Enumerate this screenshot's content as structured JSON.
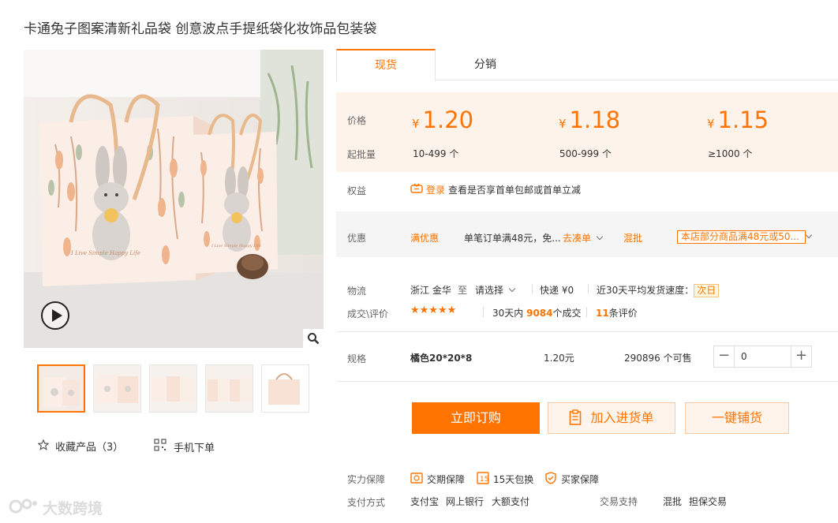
{
  "title": "卡通兔子图案清新礼品袋 创意波点手提纸袋化妆饰品包装袋",
  "tabs": [
    "现货",
    "分销"
  ],
  "price_section": {
    "price_label": "价格",
    "moq_label": "起批量",
    "currency": "¥",
    "tiers": [
      {
        "price": "1.20",
        "range": "10-499 个"
      },
      {
        "price": "1.18",
        "range": "500-999 个"
      },
      {
        "price": "1.15",
        "range": "≥1000 个"
      }
    ]
  },
  "benefits": {
    "label": "权益",
    "login": "登录",
    "text": "查看是否享首单包邮或首单立减"
  },
  "promo": {
    "label": "优惠",
    "name": "满优惠",
    "desc": "单笔订单满48元，免...",
    "action": "去凑单",
    "mixed": "混批",
    "tag": "本店部分商品满48元或50..."
  },
  "logistics": {
    "label": "物流",
    "from": "浙江 金华",
    "to_word": "至",
    "select": "请选择",
    "express": "快递 ¥0",
    "speed_label": "近30天平均发货速度：",
    "speed_value": "次日"
  },
  "deals": {
    "label": "成交\\评价",
    "stars": "★★★★★",
    "rating": 5,
    "prefix": "30天内",
    "count": "9084",
    "suffix": "个成交",
    "reviews": "11",
    "reviews_suffix": "条评价"
  },
  "spec": {
    "label": "规格",
    "name": "橘色20*20*8",
    "price": "1.20元",
    "stock": "290896 个可售",
    "quantity": "0",
    "minus": "−",
    "plus": "+"
  },
  "buttons": {
    "order": "立即订购",
    "add_cart": "加入进货单",
    "distribute": "一键铺货"
  },
  "guarantee": {
    "label": "实力保障",
    "items": [
      "交期保障",
      "15天包换",
      "买家保障"
    ]
  },
  "payment": {
    "label": "支付方式",
    "methods": [
      "支付宝",
      "网上银行",
      "大额支付"
    ],
    "trade_label": "交易支持",
    "trade": [
      "混批",
      "担保交易"
    ]
  },
  "left": {
    "favorite": "收藏产品（3）",
    "mobile": "手机下单",
    "watermark": "大数跨境",
    "image_text": "I Live Simple Happy Life"
  },
  "colors": {
    "accent": "#ff7300",
    "price_bg": "#fef3ea",
    "promo_bg": "#f5f5f5"
  }
}
